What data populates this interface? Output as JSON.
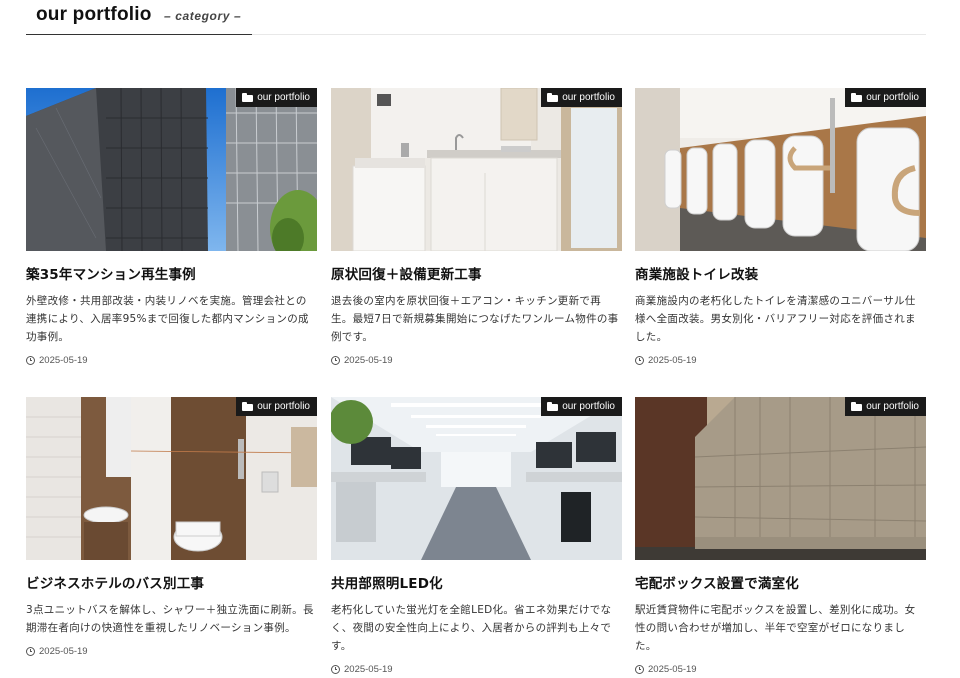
{
  "header": {
    "title": "our portfolio",
    "subtitle": "– category –"
  },
  "cards": [
    {
      "title": "築35年マンション再生事例",
      "description": "外壁改修・共用部改装・内装リノベを実施。管理会社との連携により、入居率95%まで回復した都内マンションの成功事例。",
      "date": "2025-05-19",
      "badge": "our portfolio",
      "image": "building-scaffolding"
    },
    {
      "title": "原状回復＋設備更新工事",
      "description": "退去後の室内を原状回復＋エアコン・キッチン更新で再生。最短7日で新規募集開始につなげたワンルーム物件の事例です。",
      "date": "2025-05-19",
      "badge": "our portfolio",
      "image": "kitchen-interior"
    },
    {
      "title": "商業施設トイレ改装",
      "description": "商業施設内の老朽化したトイレを清潔感のユニバーサル仕様へ全面改装。男女別化・バリアフリー対応を評価されました。",
      "date": "2025-05-19",
      "badge": "our portfolio",
      "image": "restroom-urinals"
    },
    {
      "title": "ビジネスホテルのバス別工事",
      "description": "3点ユニットバスを解体し、シャワー＋独立洗面に刷新。長期滞在者向けの快適性を重視したリノベーション事例。",
      "date": "2025-05-19",
      "badge": "our portfolio",
      "image": "hotel-bathroom"
    },
    {
      "title": "共用部照明LED化",
      "description": "老朽化していた蛍光灯を全館LED化。省エネ効果だけでなく、夜間の安全性向上により、入居者からの評判も上々です。",
      "date": "2025-05-19",
      "badge": "our portfolio",
      "image": "office-lighting"
    },
    {
      "title": "宅配ボックス設置で満室化",
      "description": "駅近賃貸物件に宅配ボックスを設置し、差別化に成功。女性の問い合わせが増加し、半年で空室がゼロになりました。",
      "date": "2025-05-19",
      "badge": "our portfolio",
      "image": "delivery-lockers"
    }
  ]
}
